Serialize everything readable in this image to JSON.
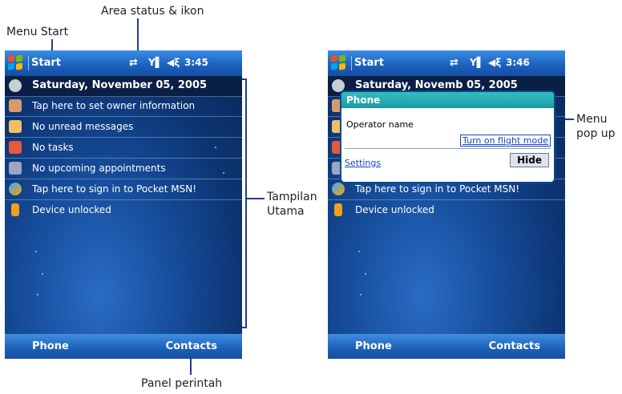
{
  "annotations": {
    "menu_start": "Menu Start",
    "area_status": "Area status & ikon",
    "tampilan_utama": "Tampilan\nUtama",
    "menu_popup": "Menu\npop up",
    "panel_perintah": "Panel perintah"
  },
  "left_screen": {
    "start_label": "Start",
    "time": "3:45",
    "date": "Saturday, November 05, 2005",
    "rows": [
      "Tap here to set owner information",
      "No unread messages",
      "No tasks",
      "No upcoming appointments",
      "Tap here to sign in to Pocket MSN!",
      "Device unlocked"
    ],
    "softkey_left": "Phone",
    "softkey_right": "Contacts"
  },
  "right_screen": {
    "start_label": "Start",
    "time": "3:46",
    "date_partial": "Saturday, Novemb   05, 2005",
    "rows": [
      "Tap here to sign in to Pocket MSN!",
      "Device unlocked"
    ],
    "popup": {
      "title": "Phone",
      "operator": "Operator name",
      "flight_mode": "Turn on flight mode",
      "settings": "Settings",
      "hide": "Hide"
    },
    "softkey_left": "Phone",
    "softkey_right": "Contacts"
  },
  "icons": {
    "windows": "windows-logo-icon",
    "sync": "sync-icon",
    "signal": "signal-icon",
    "volume": "volume-icon"
  },
  "colors": {
    "title_bar": "#1d63c0",
    "popup_header": "#1b9aa5",
    "link": "#1a44c2"
  }
}
